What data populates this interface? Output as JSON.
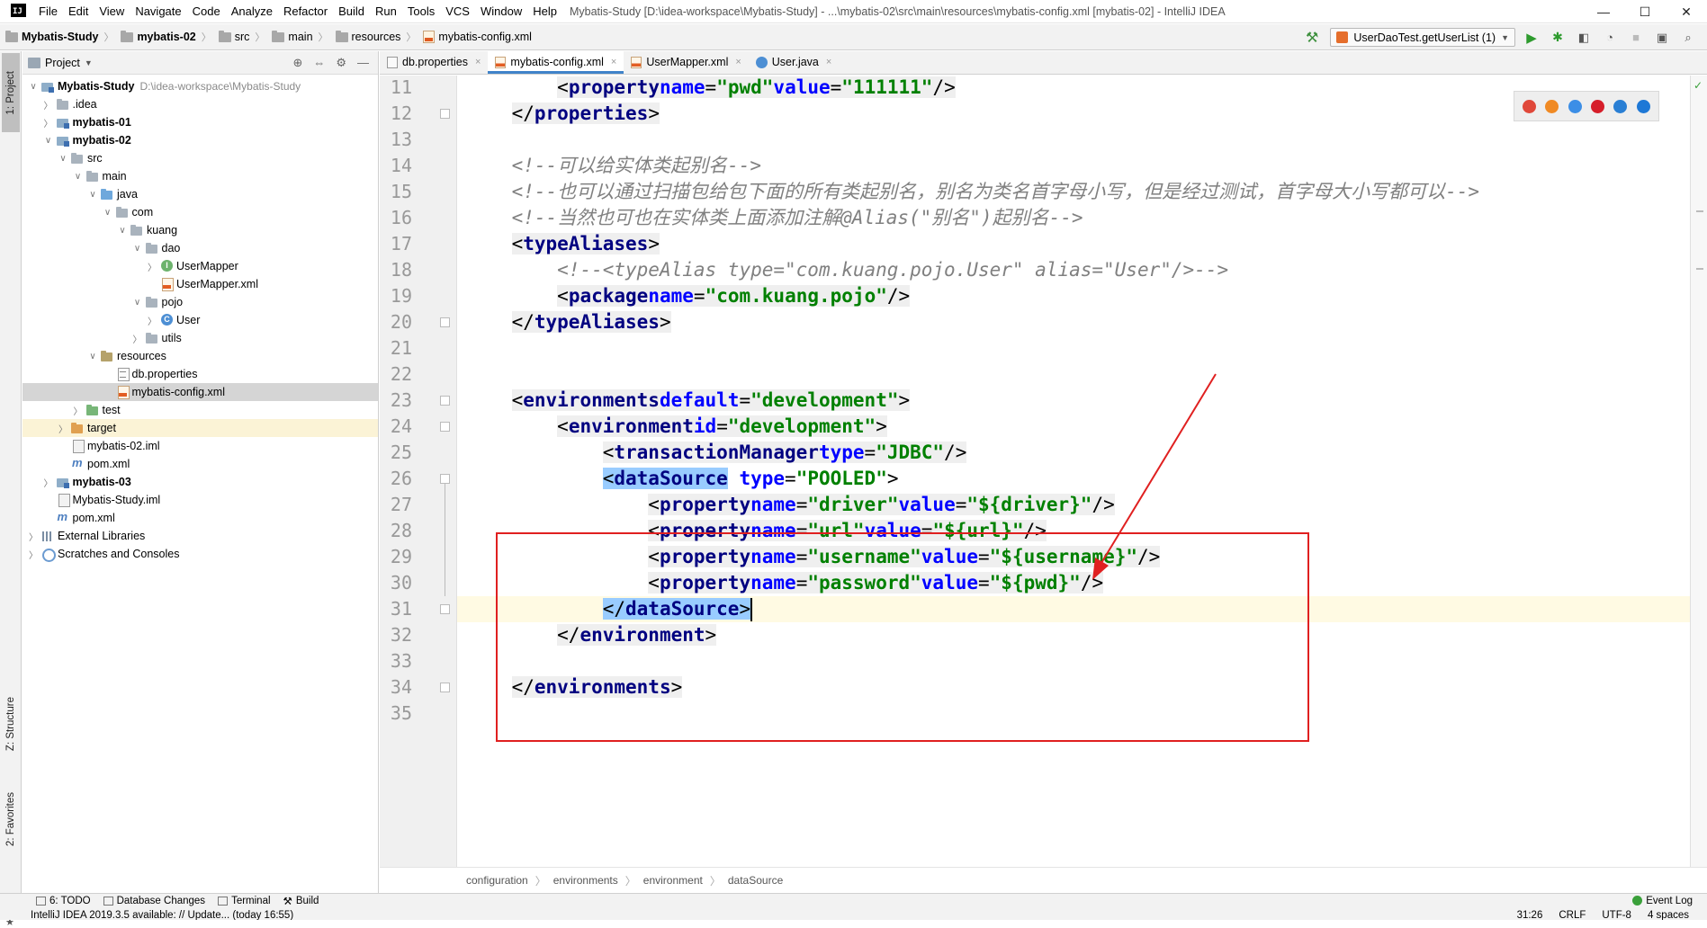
{
  "window": {
    "logo": "IJ",
    "menu": [
      "File",
      "Edit",
      "View",
      "Navigate",
      "Code",
      "Analyze",
      "Refactor",
      "Build",
      "Run",
      "Tools",
      "VCS",
      "Window",
      "Help"
    ],
    "title": "Mybatis-Study [D:\\idea-workspace\\Mybatis-Study] - ...\\mybatis-02\\src\\main\\resources\\mybatis-config.xml [mybatis-02] - IntelliJ IDEA",
    "controls": {
      "minimize": "—",
      "maximize": "☐",
      "close": "✕"
    }
  },
  "navbar": {
    "crumbs": [
      "Mybatis-Study",
      "mybatis-02",
      "src",
      "main",
      "resources",
      "mybatis-config.xml"
    ],
    "run_config": "UserDaoTest.getUserList (1)"
  },
  "tool_strip": {
    "project": "1: Project",
    "structure": "Z: Structure",
    "favorites": "2: Favorites"
  },
  "project_panel": {
    "title": "Project",
    "tree": [
      {
        "depth": 0,
        "arrow": "open",
        "icon": "module",
        "label": "Mybatis-Study",
        "bold": true,
        "path": "D:\\idea-workspace\\Mybatis-Study"
      },
      {
        "depth": 1,
        "arrow": "closed",
        "icon": "folder",
        "label": ".idea"
      },
      {
        "depth": 1,
        "arrow": "closed",
        "icon": "module",
        "label": "mybatis-01",
        "bold": true
      },
      {
        "depth": 1,
        "arrow": "open",
        "icon": "module",
        "label": "mybatis-02",
        "bold": true
      },
      {
        "depth": 2,
        "arrow": "open",
        "icon": "folder",
        "label": "src"
      },
      {
        "depth": 3,
        "arrow": "open",
        "icon": "folder",
        "label": "main"
      },
      {
        "depth": 4,
        "arrow": "open",
        "icon": "folder-src",
        "label": "java"
      },
      {
        "depth": 5,
        "arrow": "open",
        "icon": "folder",
        "label": "com"
      },
      {
        "depth": 6,
        "arrow": "open",
        "icon": "folder",
        "label": "kuang"
      },
      {
        "depth": 7,
        "arrow": "open",
        "icon": "folder",
        "label": "dao"
      },
      {
        "depth": 8,
        "arrow": "closed",
        "icon": "iface",
        "label": "UserMapper"
      },
      {
        "depth": 8,
        "arrow": "none",
        "icon": "xml",
        "label": "UserMapper.xml"
      },
      {
        "depth": 7,
        "arrow": "open",
        "icon": "folder",
        "label": "pojo"
      },
      {
        "depth": 8,
        "arrow": "closed",
        "icon": "cls",
        "label": "User"
      },
      {
        "depth": 7,
        "arrow": "closed",
        "icon": "folder",
        "label": "utils"
      },
      {
        "depth": 4,
        "arrow": "open",
        "icon": "folder-res",
        "label": "resources"
      },
      {
        "depth": 5,
        "arrow": "none",
        "icon": "props",
        "label": "db.properties"
      },
      {
        "depth": 5,
        "arrow": "none",
        "icon": "xml",
        "label": "mybatis-config.xml",
        "selected": true
      },
      {
        "depth": 3,
        "arrow": "closed",
        "icon": "folder-test",
        "label": "test"
      },
      {
        "depth": 2,
        "arrow": "closed",
        "icon": "folder-target",
        "label": "target",
        "excluded": true
      },
      {
        "depth": 2,
        "arrow": "none",
        "icon": "iml",
        "label": "mybatis-02.iml"
      },
      {
        "depth": 2,
        "arrow": "none",
        "icon": "pom",
        "label": "pom.xml"
      },
      {
        "depth": 1,
        "arrow": "closed",
        "icon": "module",
        "label": "mybatis-03",
        "bold": true
      },
      {
        "depth": 1,
        "arrow": "none",
        "icon": "iml",
        "label": "Mybatis-Study.iml"
      },
      {
        "depth": 1,
        "arrow": "none",
        "icon": "pom",
        "label": "pom.xml"
      },
      {
        "depth": 0,
        "arrow": "closed",
        "icon": "lib",
        "label": "External Libraries"
      },
      {
        "depth": 0,
        "arrow": "closed",
        "icon": "scratch",
        "label": "Scratches and Consoles"
      }
    ]
  },
  "editor": {
    "tabs": [
      {
        "label": "db.properties",
        "icon": "props",
        "active": false
      },
      {
        "label": "mybatis-config.xml",
        "icon": "xml",
        "active": true
      },
      {
        "label": "UserMapper.xml",
        "icon": "xml",
        "active": false
      },
      {
        "label": "User.java",
        "icon": "cls",
        "active": false
      }
    ],
    "current_line": 31,
    "lines": [
      {
        "n": 11,
        "tokens": [
          [
            "ws",
            "        "
          ],
          [
            "br",
            "<"
          ],
          [
            "tag",
            "property"
          ],
          [
            "ws",
            " "
          ],
          [
            "attr",
            "name"
          ],
          [
            "br",
            "="
          ],
          [
            "val",
            "\"pwd\""
          ],
          [
            "ws",
            " "
          ],
          [
            "attr",
            "value"
          ],
          [
            "br",
            "="
          ],
          [
            "val",
            "\"111111\""
          ],
          [
            "br",
            "/>"
          ]
        ]
      },
      {
        "n": 12,
        "tokens": [
          [
            "ws",
            "    "
          ],
          [
            "br",
            "</"
          ],
          [
            "tag",
            "properties"
          ],
          [
            "br",
            ">"
          ]
        ]
      },
      {
        "n": 13,
        "tokens": []
      },
      {
        "n": 14,
        "tokens": [
          [
            "ws",
            "    "
          ],
          [
            "cmt",
            "<!--可以给实体类起别名-->"
          ]
        ]
      },
      {
        "n": 15,
        "tokens": [
          [
            "ws",
            "    "
          ],
          [
            "cmt",
            "<!--也可以通过扫描包给包下面的所有类起别名，别名为类名首字母小写，但是经过测试，首字母大小写都可以-->"
          ]
        ]
      },
      {
        "n": 16,
        "tokens": [
          [
            "ws",
            "    "
          ],
          [
            "cmt",
            "<!--当然也可也在实体类上面添加注解@Alias(\"别名\")起别名-->"
          ]
        ]
      },
      {
        "n": 17,
        "tokens": [
          [
            "ws",
            "    "
          ],
          [
            "br",
            "<"
          ],
          [
            "tag",
            "typeAliases"
          ],
          [
            "br",
            ">"
          ]
        ]
      },
      {
        "n": 18,
        "tokens": [
          [
            "ws",
            "        "
          ],
          [
            "cmt",
            "<!--<typeAlias type=\"com.kuang.pojo.User\" alias=\"User\"/>-->"
          ]
        ]
      },
      {
        "n": 19,
        "tokens": [
          [
            "ws",
            "        "
          ],
          [
            "br",
            "<"
          ],
          [
            "tag",
            "package"
          ],
          [
            "ws",
            " "
          ],
          [
            "attr",
            "name"
          ],
          [
            "br",
            "="
          ],
          [
            "val",
            "\"com.kuang.pojo\""
          ],
          [
            "br",
            "/>"
          ]
        ]
      },
      {
        "n": 20,
        "tokens": [
          [
            "ws",
            "    "
          ],
          [
            "br",
            "</"
          ],
          [
            "tag",
            "typeAliases"
          ],
          [
            "br",
            ">"
          ]
        ]
      },
      {
        "n": 21,
        "tokens": []
      },
      {
        "n": 22,
        "tokens": []
      },
      {
        "n": 23,
        "tokens": [
          [
            "ws",
            "    "
          ],
          [
            "br",
            "<"
          ],
          [
            "tag",
            "environments"
          ],
          [
            "ws",
            " "
          ],
          [
            "attr",
            "default"
          ],
          [
            "br",
            "="
          ],
          [
            "val",
            "\"development\""
          ],
          [
            "br",
            ">"
          ]
        ]
      },
      {
        "n": 24,
        "tokens": [
          [
            "ws",
            "        "
          ],
          [
            "br",
            "<"
          ],
          [
            "tag",
            "environment"
          ],
          [
            "ws",
            " "
          ],
          [
            "attr",
            "id"
          ],
          [
            "br",
            "="
          ],
          [
            "val",
            "\"development\""
          ],
          [
            "br",
            ">"
          ]
        ]
      },
      {
        "n": 25,
        "tokens": [
          [
            "ws",
            "            "
          ],
          [
            "br",
            "<"
          ],
          [
            "tag",
            "transactionManager"
          ],
          [
            "ws",
            " "
          ],
          [
            "attr",
            "type"
          ],
          [
            "br",
            "="
          ],
          [
            "val",
            "\"JDBC\""
          ],
          [
            "br",
            "/>"
          ]
        ]
      },
      {
        "n": 26,
        "tokens": [
          [
            "ws",
            "            "
          ],
          [
            "mbr",
            "<"
          ],
          [
            "mtag",
            "dataSource"
          ],
          [
            "ws",
            " "
          ],
          [
            "attr",
            "type"
          ],
          [
            "br",
            "="
          ],
          [
            "val",
            "\"POOLED\""
          ],
          [
            "br",
            ">"
          ]
        ]
      },
      {
        "n": 27,
        "tokens": [
          [
            "ws",
            "                "
          ],
          [
            "br",
            "<"
          ],
          [
            "tag",
            "property"
          ],
          [
            "ws",
            " "
          ],
          [
            "attr",
            "name"
          ],
          [
            "br",
            "="
          ],
          [
            "val",
            "\"driver\""
          ],
          [
            "ws",
            " "
          ],
          [
            "attr",
            "value"
          ],
          [
            "br",
            "="
          ],
          [
            "val",
            "\"${driver}\""
          ],
          [
            "br",
            "/>"
          ]
        ]
      },
      {
        "n": 28,
        "tokens": [
          [
            "ws",
            "                "
          ],
          [
            "br",
            "<"
          ],
          [
            "tag",
            "property"
          ],
          [
            "ws",
            " "
          ],
          [
            "attr",
            "name"
          ],
          [
            "br",
            "="
          ],
          [
            "val",
            "\"url\""
          ],
          [
            "ws",
            " "
          ],
          [
            "attr",
            "value"
          ],
          [
            "br",
            "="
          ],
          [
            "val",
            "\"${url}\""
          ],
          [
            "br",
            "/>"
          ]
        ]
      },
      {
        "n": 29,
        "tokens": [
          [
            "ws",
            "                "
          ],
          [
            "br",
            "<"
          ],
          [
            "tag",
            "property"
          ],
          [
            "ws",
            " "
          ],
          [
            "attr",
            "name"
          ],
          [
            "br",
            "="
          ],
          [
            "val",
            "\"username\""
          ],
          [
            "ws",
            " "
          ],
          [
            "attr",
            "value"
          ],
          [
            "br",
            "="
          ],
          [
            "val",
            "\"${username}\""
          ],
          [
            "br",
            "/>"
          ]
        ]
      },
      {
        "n": 30,
        "tokens": [
          [
            "ws",
            "                "
          ],
          [
            "br",
            "<"
          ],
          [
            "tag",
            "property"
          ],
          [
            "ws",
            " "
          ],
          [
            "attr",
            "name"
          ],
          [
            "br",
            "="
          ],
          [
            "val",
            "\"password\""
          ],
          [
            "ws",
            " "
          ],
          [
            "attr",
            "value"
          ],
          [
            "br",
            "="
          ],
          [
            "val",
            "\"${pwd}\""
          ],
          [
            "br",
            "/>"
          ]
        ]
      },
      {
        "n": 31,
        "tokens": [
          [
            "ws",
            "            "
          ],
          [
            "mbr",
            "</"
          ],
          [
            "mtag",
            "dataSource"
          ],
          [
            "mbr",
            ">"
          ],
          [
            "caret",
            ""
          ]
        ]
      },
      {
        "n": 32,
        "tokens": [
          [
            "ws",
            "        "
          ],
          [
            "br",
            "</"
          ],
          [
            "tag",
            "environment"
          ],
          [
            "br",
            ">"
          ]
        ]
      },
      {
        "n": 33,
        "tokens": []
      },
      {
        "n": 34,
        "tokens": [
          [
            "ws",
            "    "
          ],
          [
            "br",
            "</"
          ],
          [
            "tag",
            "environments"
          ],
          [
            "br",
            ">"
          ]
        ]
      },
      {
        "n": 35,
        "tokens": []
      }
    ],
    "fold_lines": [
      12,
      20,
      23,
      24,
      26,
      31,
      34
    ],
    "breadcrumb": [
      "configuration",
      "environments",
      "environment",
      "dataSource"
    ],
    "browsers": [
      {
        "name": "chrome",
        "color": "#e0483a"
      },
      {
        "name": "firefox",
        "color": "#f08a24"
      },
      {
        "name": "safari",
        "color": "#3c8ee6"
      },
      {
        "name": "opera",
        "color": "#d61e2a"
      },
      {
        "name": "ie",
        "color": "#2a7fd4"
      },
      {
        "name": "edge",
        "color": "#1e78d6"
      }
    ]
  },
  "bottom_bar": {
    "items": [
      "6: TODO",
      "Database Changes",
      "Terminal",
      "Build"
    ],
    "event_log": "Event Log"
  },
  "status": {
    "message": "IntelliJ IDEA 2019.3.5 available: // Update... (today 16:55)",
    "position": "31:26",
    "line_sep": "CRLF",
    "encoding": "UTF-8",
    "indent": "4 spaces"
  },
  "annotation": {
    "box_color": "#e02020"
  }
}
